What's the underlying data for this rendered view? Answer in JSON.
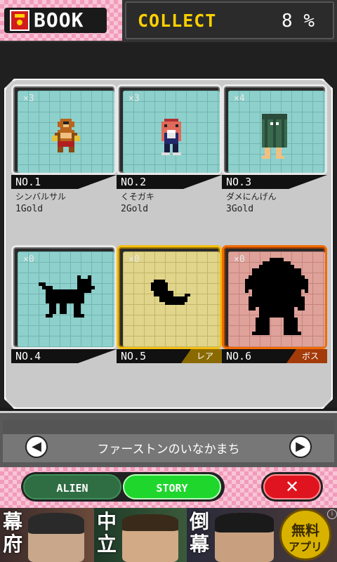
{
  "header": {
    "book_label": "BOOK",
    "collect_label": "COLLECT",
    "collect_value": "8 %"
  },
  "cards": [
    {
      "count": "×3",
      "number": "NO.1",
      "name": "シンバルサル",
      "price": "1Gold",
      "rarity": ""
    },
    {
      "count": "×3",
      "number": "NO.2",
      "name": "くそガキ",
      "price": "2Gold",
      "rarity": ""
    },
    {
      "count": "×4",
      "number": "NO.3",
      "name": "ダメにんげん",
      "price": "3Gold",
      "rarity": ""
    },
    {
      "count": "×0",
      "number": "NO.4",
      "name": "",
      "price": "",
      "rarity": ""
    },
    {
      "count": "×0",
      "number": "NO.5",
      "name": "",
      "price": "",
      "rarity": "レア"
    },
    {
      "count": "×0",
      "number": "NO.6",
      "name": "",
      "price": "",
      "rarity": "ボス"
    }
  ],
  "stage": {
    "name": "ファーストンのいなかまち"
  },
  "tabs": {
    "alien_label": "ALIEN",
    "story_label": "STORY",
    "active": "STORY"
  },
  "ad": {
    "text1": "幕府",
    "text2": "中立",
    "text3": "倒幕",
    "badge_line1": "無料",
    "badge_line2": "アプリ"
  },
  "colors": {
    "collect_accent": "#ffd000",
    "rare_frame": "#f4be12",
    "boss_frame": "#f26b00",
    "story_tab": "#1fd62d",
    "close_button": "#e0141e"
  }
}
